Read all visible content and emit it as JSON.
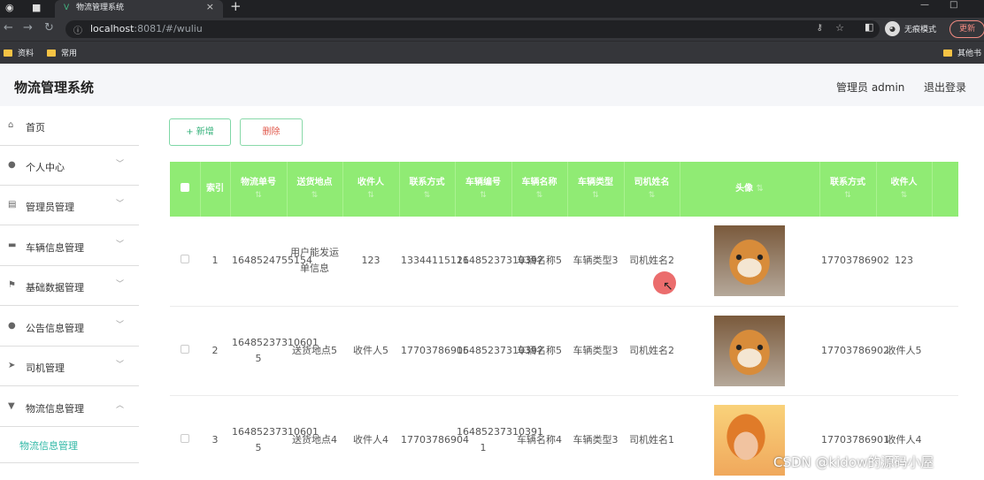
{
  "browser": {
    "tab_title": "物流管理系统",
    "url_host": "localhost",
    "url_path": ":8081/#/wuliu",
    "profile_label": "无痕模式",
    "update_label": "更新",
    "bookmarks": [
      "资料",
      "常用",
      "其他书"
    ]
  },
  "header": {
    "app_title": "物流管理系统",
    "admin_label": "管理员 admin",
    "logout_label": "退出登录"
  },
  "sidebar": {
    "items": [
      {
        "label": "首页",
        "icon": "home-icon"
      },
      {
        "label": "个人中心",
        "icon": "user-icon"
      },
      {
        "label": "管理员管理",
        "icon": "briefcase-icon"
      },
      {
        "label": "车辆信息管理",
        "icon": "chat-icon"
      },
      {
        "label": "基础数据管理",
        "icon": "flag-icon"
      },
      {
        "label": "公告信息管理",
        "icon": "location-icon"
      },
      {
        "label": "司机管理",
        "icon": "send-icon"
      },
      {
        "label": "物流信息管理",
        "icon": "cargo-icon"
      }
    ],
    "active_sub": "物流信息管理"
  },
  "toolbar": {
    "add_label": "+ 新增",
    "delete_label": "删除"
  },
  "table": {
    "columns": [
      "索引",
      "物流单号",
      "送货地点",
      "收件人",
      "联系方式",
      "车辆编号",
      "车辆名称",
      "车辆类型",
      "司机姓名",
      "头像",
      "联系方式",
      "收件人"
    ],
    "rows": [
      {
        "index": "1",
        "tracking": "1648524755154",
        "place": "用户能发运单信息",
        "receiver": "123",
        "phone": "13344115121",
        "vehicle_no": "16485237310397",
        "vehicle_name": "车辆名称5",
        "vehicle_type": "车辆类型3",
        "driver": "司机姓名2",
        "photo": "shiba-dog",
        "driver_phone": "17703786902",
        "receiver2": "123"
      },
      {
        "index": "2",
        "tracking": "16485237310601 5",
        "place": "送货地点5",
        "receiver": "收件人5",
        "phone": "17703786905",
        "vehicle_no": "16485237310397",
        "vehicle_name": "车辆名称5",
        "vehicle_type": "车辆类型3",
        "driver": "司机姓名2",
        "photo": "shiba-dog",
        "driver_phone": "17703786902",
        "receiver2": "收件人5"
      },
      {
        "index": "3",
        "tracking": "16485237310601 5",
        "place": "送货地点4",
        "receiver": "收件人4",
        "phone": "17703786904",
        "vehicle_no": "16485237310391 1",
        "vehicle_name": "车辆名称4",
        "vehicle_type": "车辆类型3",
        "driver": "司机姓名1",
        "photo": "girl",
        "driver_phone": "17703786901",
        "receiver2": "收件人4"
      }
    ]
  },
  "watermark": "CSDN @kidow的源码小屋"
}
